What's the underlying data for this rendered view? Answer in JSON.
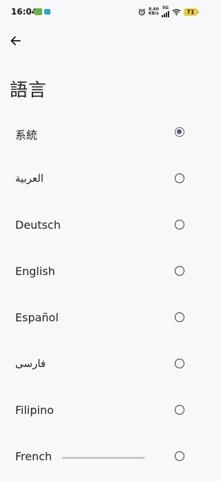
{
  "status_bar": {
    "time": "16:04",
    "network_speed_value": "8.40",
    "network_speed_unit": "KB/s",
    "network_type": "5G",
    "battery_level": "71",
    "icons": [
      "game-notification-icon",
      "message-notification-icon",
      "alarm-icon",
      "signal-icon",
      "wifi-icon",
      "battery-icon"
    ],
    "colors": {
      "notification_green": "#67b346",
      "notification_blue": "#2ba5d6",
      "battery": "#e9cb3f"
    }
  },
  "header": {
    "back_icon": "arrow-left-icon",
    "title": "語言"
  },
  "languages": [
    {
      "label": "系統",
      "selected": true
    },
    {
      "label": "العربية",
      "selected": false
    },
    {
      "label": "Deutsch",
      "selected": false
    },
    {
      "label": "English",
      "selected": false
    },
    {
      "label": "Español",
      "selected": false
    },
    {
      "label": "فارسی",
      "selected": false
    },
    {
      "label": "Filipino",
      "selected": false
    },
    {
      "label": "French",
      "selected": false
    }
  ],
  "colors": {
    "background": "#f7f8fa",
    "radio_selected": "#5a5870"
  }
}
